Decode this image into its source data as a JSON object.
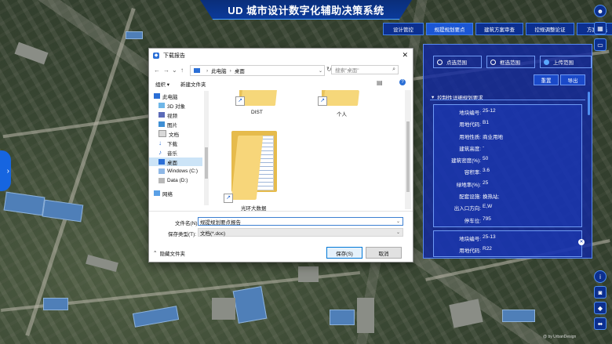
{
  "app": {
    "title": "UD 城市设计数字化辅助决策系统"
  },
  "nav_tabs": [
    {
      "label": "设计管控",
      "active": false
    },
    {
      "label": "规提规划要点",
      "active": true
    },
    {
      "label": "建筑方案审查",
      "active": false
    },
    {
      "label": "控规调整论证",
      "active": false
    },
    {
      "label": "方案比选",
      "active": false
    }
  ],
  "right_panel": {
    "radios": [
      {
        "label": "点选范围",
        "selected": false
      },
      {
        "label": "框选范围",
        "selected": false
      },
      {
        "label": "上传范围",
        "selected": true
      }
    ],
    "reset_label": "重置",
    "export_label": "导出",
    "section_title": "控制性详细规划要求",
    "card1": [
      {
        "key": "地块编号:",
        "value": "25-12"
      },
      {
        "key": "用地代码:",
        "value": "B1"
      },
      {
        "key": "用地性质:",
        "value": "商业用地"
      },
      {
        "key": "建筑高度:",
        "value": "-"
      },
      {
        "key": "建筑密度(%):",
        "value": "50"
      },
      {
        "key": "容积率:",
        "value": "3.6"
      },
      {
        "key": "绿地率(%):",
        "value": "25"
      },
      {
        "key": "配套设施:",
        "value": "换热站;"
      },
      {
        "key": "出入口方向:",
        "value": "E,W"
      },
      {
        "key": "停车位:",
        "value": "795"
      }
    ],
    "card2": [
      {
        "key": "地块编号:",
        "value": "25-13"
      },
      {
        "key": "用地代码:",
        "value": "R22"
      }
    ]
  },
  "dialog": {
    "title": "下载报告",
    "close": "✕",
    "breadcrumb": [
      "此电脑",
      "桌面"
    ],
    "search_placeholder": "搜索\"桌面\"",
    "organize_label": "组织 ▾",
    "new_folder_label": "新建文件夹",
    "nav_items": [
      {
        "label": "此电脑",
        "icon": "pc-icon",
        "indent": 0
      },
      {
        "label": "3D 对象",
        "icon": "cube-icon",
        "indent": 1
      },
      {
        "label": "视频",
        "icon": "video-icon",
        "indent": 1
      },
      {
        "label": "图片",
        "icon": "picture-icon",
        "indent": 1
      },
      {
        "label": "文档",
        "icon": "document-icon",
        "indent": 1
      },
      {
        "label": "下载",
        "icon": "download-icon",
        "indent": 1
      },
      {
        "label": "音乐",
        "icon": "music-icon",
        "indent": 1
      },
      {
        "label": "桌面",
        "icon": "desktop-icon",
        "indent": 1,
        "selected": true
      },
      {
        "label": "Windows (C:)",
        "icon": "drive-icon",
        "indent": 1
      },
      {
        "label": "Data (D:)",
        "icon": "drive-icon",
        "indent": 1
      },
      {
        "label": "网络",
        "icon": "network-icon",
        "indent": 0
      }
    ],
    "folders": [
      {
        "label": "DIST"
      },
      {
        "label": "个人"
      },
      {
        "label": "光环大数据"
      }
    ],
    "filename_label": "文件名(N):",
    "filename_value": "规提规划要点报告",
    "filetype_label": "保存类型(T):",
    "filetype_value": "文档(*.doc)",
    "hide_folders_label": "隐藏文件夹",
    "save_label": "保存(S)",
    "cancel_label": "取消"
  },
  "watermark": "@ by UrbanDesign"
}
